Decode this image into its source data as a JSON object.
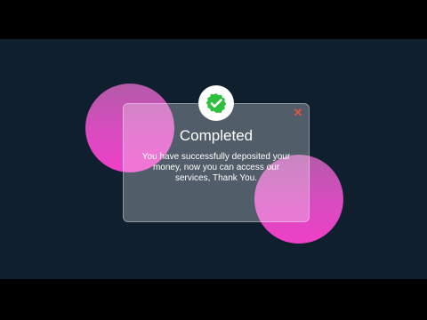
{
  "dialog": {
    "title": "Completed",
    "message": "You have successfully deposited your money, now you can access our services, Thank You.",
    "close_icon": "close-icon",
    "status_icon": "check-icon"
  },
  "colors": {
    "background": "#0f1f2e",
    "accent_pink": "#ee3fc6",
    "success_green": "#2fbf3f",
    "close_red": "#e5533f"
  }
}
